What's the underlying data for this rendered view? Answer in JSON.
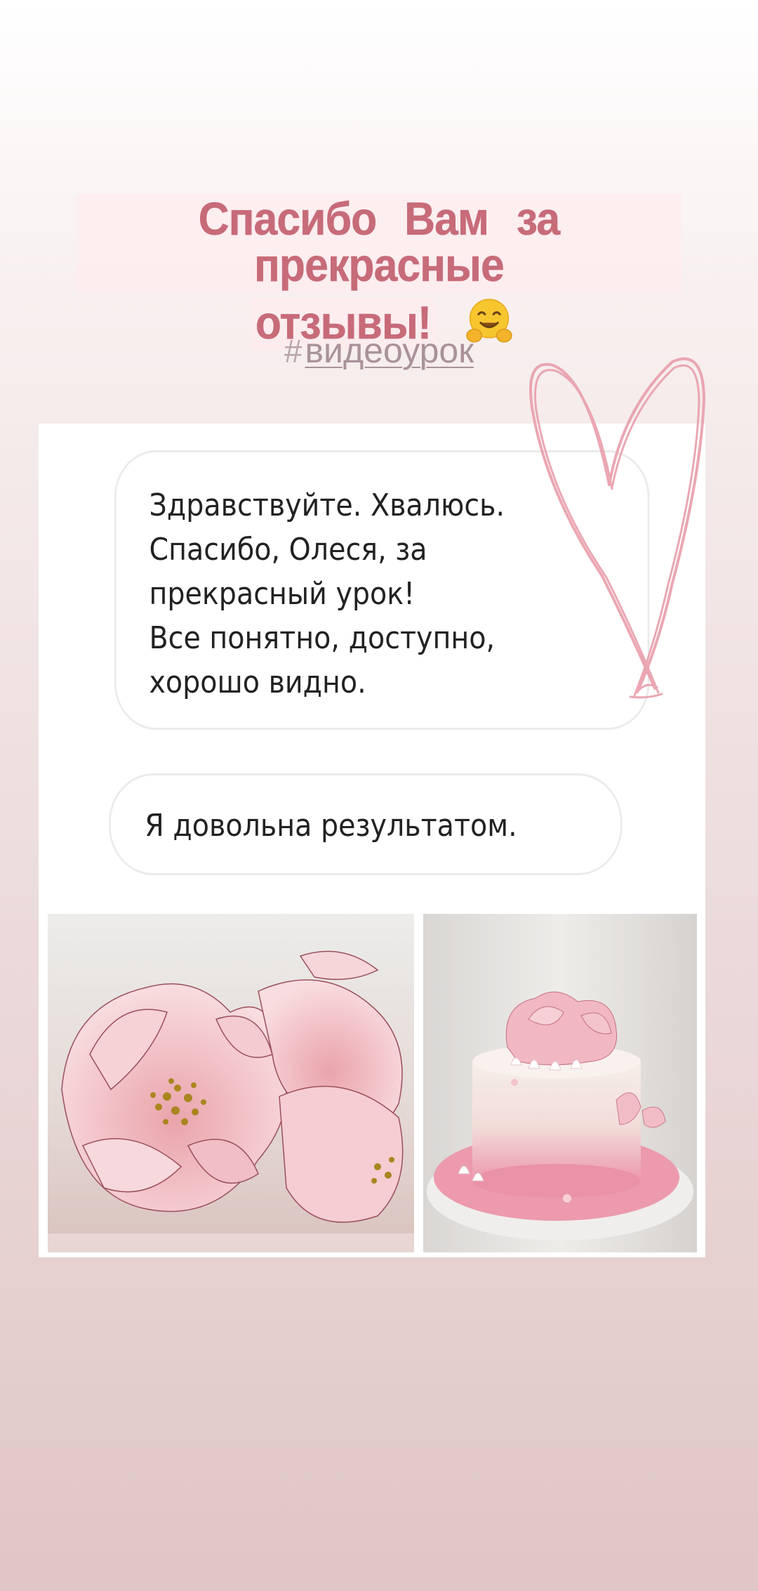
{
  "story": {
    "title_line1": "Спасибо Вам за прекрасные",
    "title_line2": "отзывы!",
    "hashtag": "видеоурок",
    "hashtag_symbol": "#",
    "title_color": "#c76b79"
  },
  "review": {
    "message_lines": [
      "Здравствуйте. Хвалюсь.",
      "Спасибо, Олеся, за",
      "прекрасный урок!",
      "Все понятно, доступно,",
      "хорошо видно."
    ],
    "reply": "Я довольна результатом."
  },
  "icons": {
    "emoji": "hugging-face-icon",
    "sticker": "heart-doodle-icon"
  }
}
